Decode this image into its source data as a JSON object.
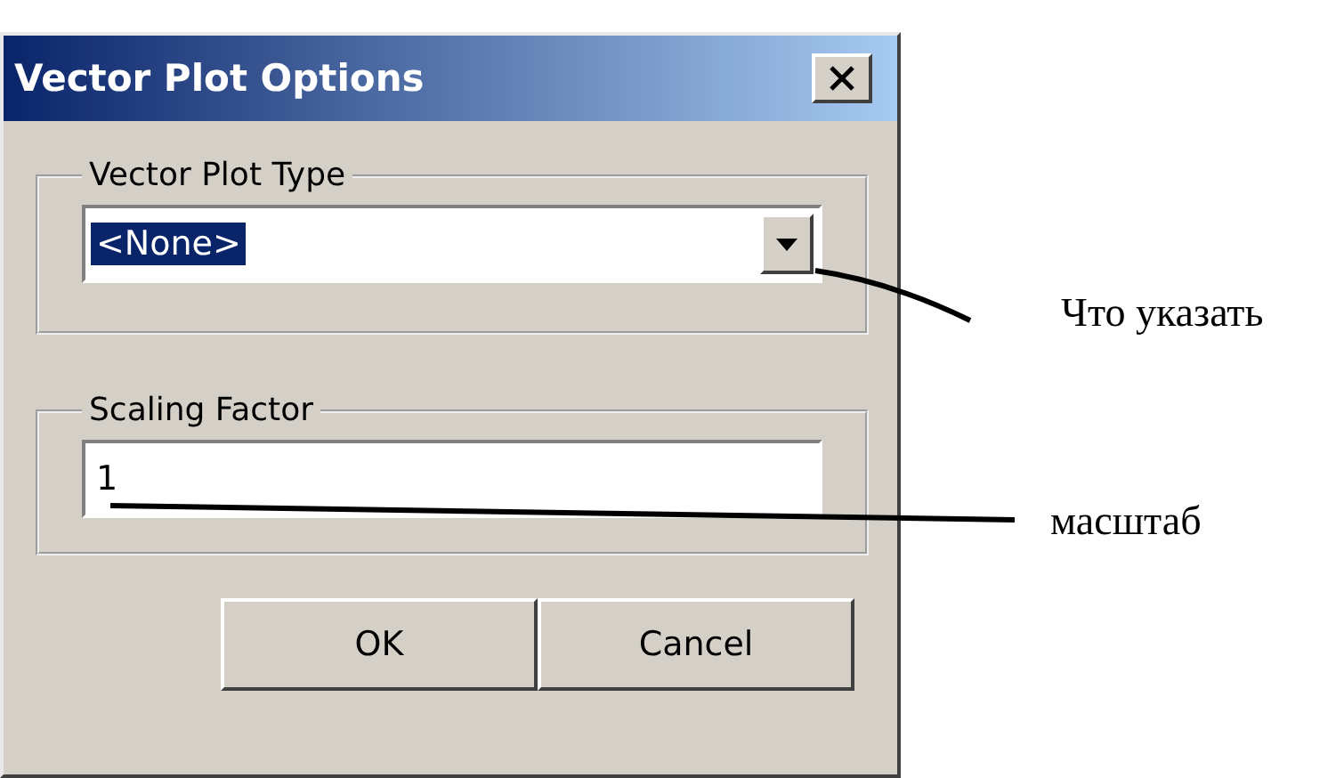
{
  "window": {
    "title": "Vector Plot Options"
  },
  "groups": [
    {
      "label": "Vector Plot Type",
      "kind": "dropdown",
      "value": "<None>",
      "highlighted": true
    },
    {
      "label": "Scaling Factor",
      "kind": "text",
      "value": "1",
      "highlighted": false
    }
  ],
  "buttons": [
    "OK",
    "Cancel"
  ],
  "annotations": [
    "Что указать",
    "масштаб"
  ]
}
